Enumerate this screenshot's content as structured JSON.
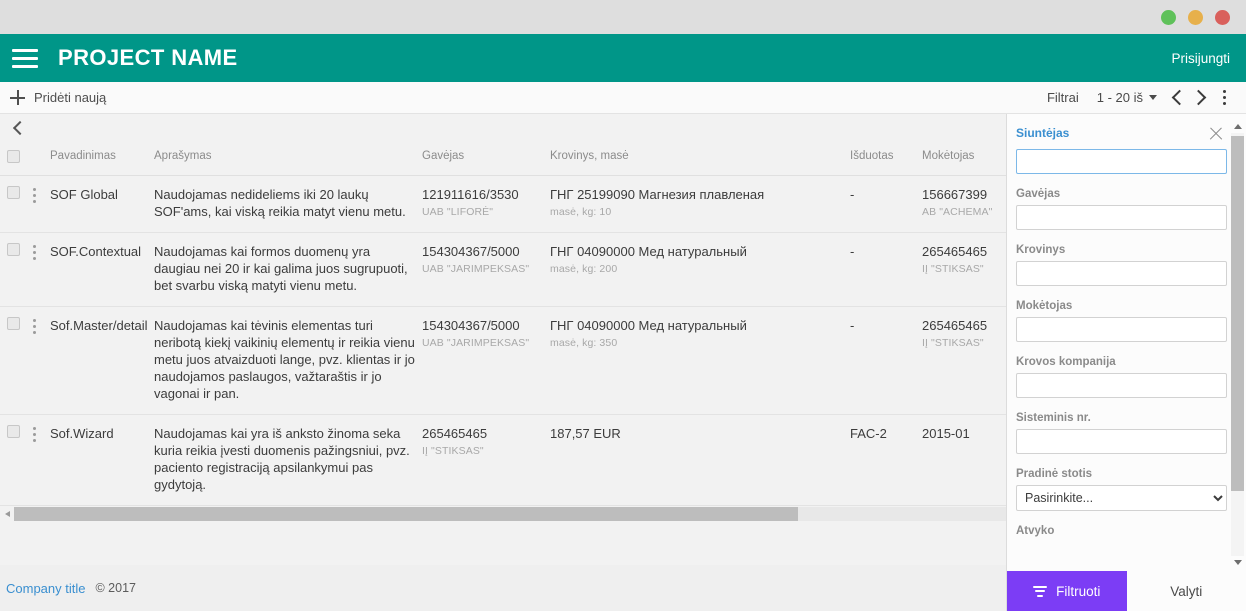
{
  "window": {
    "dots": [
      "green",
      "amber",
      "red"
    ]
  },
  "appbar": {
    "title": "PROJECT NAME",
    "login_label": "Prisijungti"
  },
  "toolbar": {
    "add_new_label": "Pridėti naują",
    "filters_label": "Filtrai",
    "range_label": "1 - 20 iš"
  },
  "grid": {
    "headers": {
      "name": "Pavadinimas",
      "description": "Aprašymas",
      "receiver": "Gavėjas",
      "cargo": "Krovinys, masė",
      "issued": "Išduotas",
      "payer": "Mokėtojas"
    },
    "rows": [
      {
        "name": "SOF Global",
        "description": "Naudojamas nedideliems iki 20 laukų SOF'ams, kai viską reikia matyt vienu metu.",
        "receiver": "121911616/3530",
        "receiver_sub": "UAB \"LIFORĖ\"",
        "cargo": "ГНГ 25199090 Магнезия плавленая",
        "cargo_sub": "masė, kg: 10",
        "issued": "-",
        "payer": "156667399",
        "payer_sub": "AB \"ACHEMA\""
      },
      {
        "name": "SOF.Contextual",
        "description": "Naudojamas kai formos duomenų yra daugiau nei 20 ir kai galima juos sugrupuoti, bet svarbu viską matyti vienu metu.",
        "receiver": "154304367/5000",
        "receiver_sub": "UAB \"JARIMPEKSAS\"",
        "cargo": "ГНГ 04090000 Мед натуральный",
        "cargo_sub": "masė, kg: 200",
        "issued": "-",
        "payer": "265465465",
        "payer_sub": "IĮ \"STIKSAS\""
      },
      {
        "name": "Sof.Master/detail",
        "description": "Naudojamas kai tėvinis elementas turi neribotą kiekį vaikinių elementų ir reikia vienu metu juos atvaizduoti lange, pvz. klientas ir jo naudojamos paslaugos, važtaraštis ir jo vagonai ir pan.",
        "receiver": "154304367/5000",
        "receiver_sub": "UAB \"JARIMPEKSAS\"",
        "cargo": "ГНГ 04090000 Мед натуральный",
        "cargo_sub": "masė, kg: 350",
        "issued": "-",
        "payer": "265465465",
        "payer_sub": "IĮ \"STIKSAS\""
      },
      {
        "name": "Sof.Wizard",
        "description": "Naudojamas kai yra iš anksto žinoma seka kuria reikia įvesti duomenis pažingsniui, pvz. paciento registraciją apsilankymui pas gydytoją.",
        "receiver": "265465465",
        "receiver_sub": "IĮ \"STIKSAS\"",
        "cargo": "187,57 EUR",
        "cargo_sub": "",
        "issued": "FAC-2",
        "payer": "2015-01",
        "payer_sub": ""
      }
    ]
  },
  "filter_panel": {
    "title": "Siuntėjas",
    "fields": [
      {
        "label": "Siuntėjas",
        "value": "",
        "type": "text",
        "focused": true
      },
      {
        "label": "Gavėjas",
        "value": "",
        "type": "text"
      },
      {
        "label": "Krovinys",
        "value": "",
        "type": "text"
      },
      {
        "label": "Mokėtojas",
        "value": "",
        "type": "text"
      },
      {
        "label": "Krovos kompanija",
        "value": "",
        "type": "text"
      },
      {
        "label": "Sisteminis nr.",
        "value": "",
        "type": "text"
      },
      {
        "label": "Pradinė stotis",
        "value": "Pasirinkite...",
        "type": "select"
      },
      {
        "label": "Atvyko",
        "value": "",
        "type": "text"
      }
    ],
    "field_labels": {
      "f0": "Siuntėjas",
      "f1": "Gavėjas",
      "f2": "Krovinys",
      "f3": "Mokėtojas",
      "f4": "Krovos kompanija",
      "f5": "Sisteminis nr.",
      "f6": "Pradinė stotis",
      "f7": "Atvyko"
    },
    "station_placeholder": "Pasirinkite...",
    "filter_button": "Filtruoti",
    "clear_button": "Valyti"
  },
  "footer": {
    "company": "Company title",
    "copyright": "© 2017"
  },
  "colors": {
    "appbar": "#009688",
    "accent_link": "#3a8fd0",
    "filter_button": "#7c3df5"
  }
}
